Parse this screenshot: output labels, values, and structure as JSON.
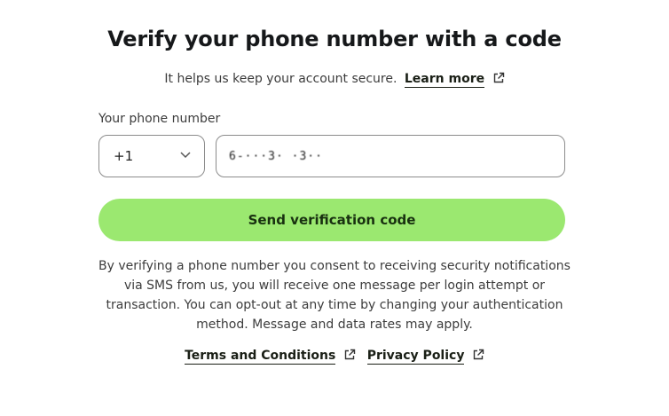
{
  "header": {
    "title": "Verify your phone number with a code",
    "subtitle_text": "It helps us keep your account secure.",
    "learn_more_label": "Learn more",
    "learn_more_icon": "external-link-icon"
  },
  "form": {
    "phone_label": "Your phone number",
    "country_code": "+1",
    "country_dropdown_icon": "chevron-down-icon",
    "phone_value": "6-···3· ·3··",
    "send_button_label": "Send verification code"
  },
  "consent": {
    "text": "By verifying a phone number you consent to receiving security notifications via SMS from us, you will receive one message per login attempt or transaction. You can opt-out at any time by changing your authentication method. Message and data rates may apply."
  },
  "footer": {
    "terms_label": "Terms and Conditions",
    "privacy_label": "Privacy Policy",
    "link_icon": "external-link-icon"
  },
  "colors": {
    "accent_button": "#9be870",
    "button_text": "#183010",
    "border": "#8c8c8c"
  }
}
